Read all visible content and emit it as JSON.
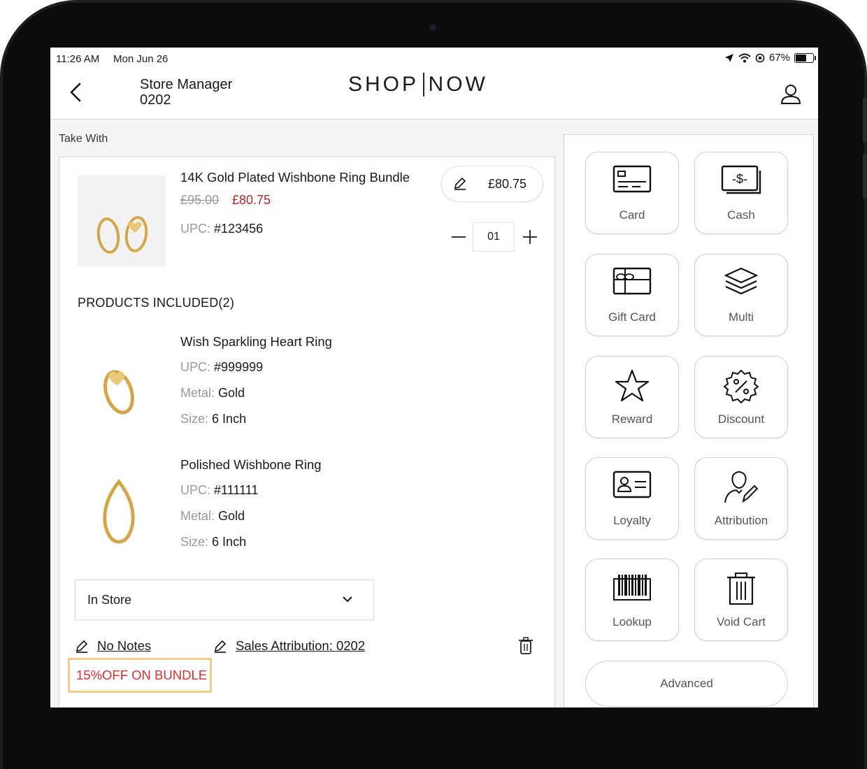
{
  "status_bar": {
    "time": "11:26 AM",
    "date": "Mon Jun 26",
    "battery": "67%",
    "battery_level": 0.67
  },
  "header": {
    "role_line1": "Store Manager",
    "role_line2": "0202",
    "logo_left": "SHOP",
    "logo_right": "NOW"
  },
  "take_with_label": "Take With",
  "bundle": {
    "title": "14K Gold Plated Wishbone Ring Bundle",
    "original_price": "£95.00",
    "sale_price": "£80.75",
    "upc_label": "UPC:",
    "upc_value": "#123456",
    "edit_price": "£80.75",
    "quantity": "01"
  },
  "included": {
    "heading": "PRODUCTS INCLUDED(2)",
    "items": [
      {
        "name": "Wish Sparkling Heart Ring",
        "upc_label": "UPC:",
        "upc_value": "#999999",
        "metal_label": "Metal:",
        "metal_value": "Gold",
        "size_label": "Size:",
        "size_value": "6 Inch"
      },
      {
        "name": "Polished Wishbone Ring",
        "upc_label": "UPC:",
        "upc_value": "#111111",
        "metal_label": "Metal:",
        "metal_value": "Gold",
        "size_label": "Size:",
        "size_value": "6 Inch"
      }
    ]
  },
  "fulfillment": {
    "selected": "In Store"
  },
  "notes_label": "No Notes",
  "attribution_label": "Sales Attribution: 0202",
  "promo_tag": "15%OFF ON BUNDLE",
  "payment": {
    "buttons": [
      {
        "label": "Card",
        "icon": "credit-card-icon"
      },
      {
        "label": "Cash",
        "icon": "cash-icon"
      },
      {
        "label": "Gift Card",
        "icon": "gift-card-icon"
      },
      {
        "label": "Multi",
        "icon": "layers-icon"
      },
      {
        "label": "Reward",
        "icon": "star-icon"
      },
      {
        "label": "Discount",
        "icon": "percent-badge-icon"
      },
      {
        "label": "Loyalty",
        "icon": "id-card-icon"
      },
      {
        "label": "Attribution",
        "icon": "user-pen-icon"
      },
      {
        "label": "Lookup",
        "icon": "barcode-icon"
      },
      {
        "label": "Void Cart",
        "icon": "trash-icon"
      }
    ],
    "advanced_label": "Advanced"
  },
  "colors": {
    "sale_red": "#b3242a",
    "promo_red": "#e02d2d",
    "promo_border": "#f2cf82",
    "gold": "#d4a64a"
  }
}
